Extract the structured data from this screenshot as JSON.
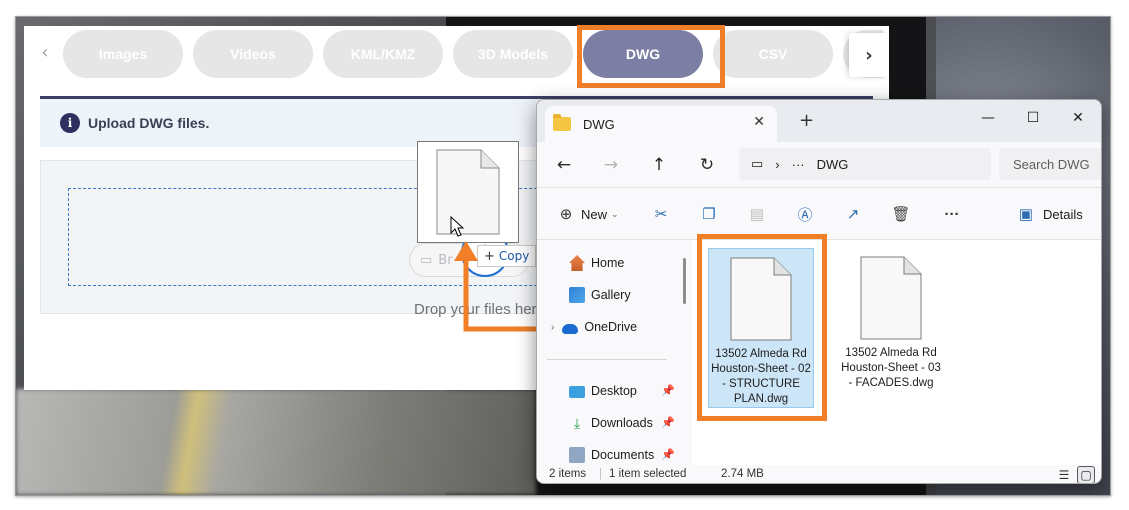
{
  "webapp": {
    "tabs": [
      {
        "label": "Images",
        "active": false
      },
      {
        "label": "Videos",
        "active": false
      },
      {
        "label": "KML/KMZ",
        "active": false
      },
      {
        "label": "3D Models",
        "active": false
      },
      {
        "label": "DWG",
        "active": true
      },
      {
        "label": "CSV",
        "active": false
      }
    ],
    "info_icon_glyph": "i",
    "info_text": "Upload DWG files.",
    "browse_label": "Br",
    "drop_text": "Drop your files here",
    "plus_glyph": "+"
  },
  "drag": {
    "copy_label": "Copy",
    "copy_plus": "+"
  },
  "explorer": {
    "tab_title": "DWG",
    "address_path": "DWG",
    "search_placeholder": "Search DWG",
    "toolbar": {
      "new_label": "New",
      "details_label": "Details"
    },
    "nav": [
      {
        "label": "Home",
        "icon": "home-icon"
      },
      {
        "label": "Gallery",
        "icon": "gallery-icon"
      },
      {
        "label": "OneDrive",
        "icon": "onedrive-icon"
      },
      {
        "label": "Desktop",
        "icon": "desktop-icon",
        "pinned": true
      },
      {
        "label": "Downloads",
        "icon": "downloads-icon",
        "pinned": true
      },
      {
        "label": "Documents",
        "icon": "documents-icon",
        "pinned": true
      }
    ],
    "files": [
      {
        "name": "13502 Almeda Rd Houston-Sheet - 02 - STRUCTURE PLAN.dwg",
        "selected": true
      },
      {
        "name": "13502 Almeda Rd Houston-Sheet - 03 - FACADES.dwg",
        "selected": false
      }
    ],
    "status": {
      "items": "2 items",
      "selection": "1 item selected",
      "size": "2.74 MB"
    }
  },
  "colors": {
    "highlight": "#f07f28",
    "active_tab": "#7c7fa3",
    "inactive_tab": "#e6e6e6",
    "info_strip": "#eef3f9",
    "selected_file": "#cde6f7"
  }
}
